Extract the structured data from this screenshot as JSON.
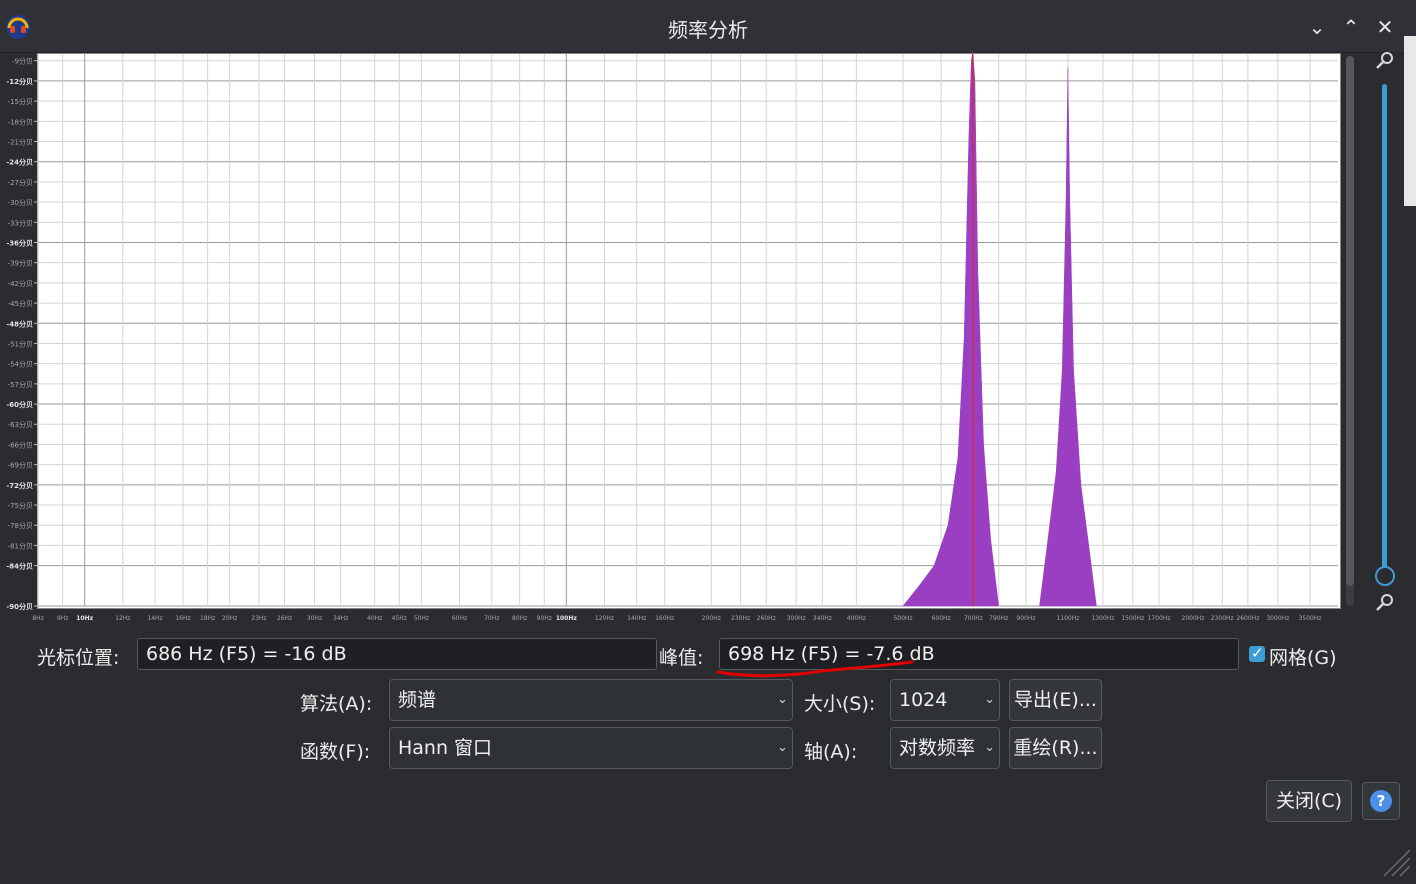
{
  "window": {
    "title": "频率分析",
    "minimize_icon": "chevron-down-icon",
    "maximize_icon": "chevron-up-icon",
    "close_icon": "close-icon",
    "minimize_glyph": "⌄",
    "maximize_glyph": "⌃",
    "close_glyph": "✕"
  },
  "chart_data": {
    "type": "area",
    "title": "",
    "xlabel": "",
    "ylabel": "",
    "x_scale": "log",
    "xlim": [
      8,
      4000
    ],
    "ylim": [
      -90,
      -8
    ],
    "grid": true,
    "y_ticks": [
      {
        "label": "-9分贝",
        "value": -9
      },
      {
        "label": "-12分贝",
        "value": -12
      },
      {
        "label": "-15分贝",
        "value": -15
      },
      {
        "label": "-18分贝",
        "value": -18
      },
      {
        "label": "-21分贝",
        "value": -21
      },
      {
        "label": "-24分贝",
        "value": -24
      },
      {
        "label": "-27分贝",
        "value": -27
      },
      {
        "label": "-30分贝",
        "value": -30
      },
      {
        "label": "-33分贝",
        "value": -33
      },
      {
        "label": "-36分贝",
        "value": -36
      },
      {
        "label": "-39分贝",
        "value": -39
      },
      {
        "label": "-42分贝",
        "value": -42
      },
      {
        "label": "-45分贝",
        "value": -45
      },
      {
        "label": "-48分贝",
        "value": -48
      },
      {
        "label": "-51分贝",
        "value": -51
      },
      {
        "label": "-54分贝",
        "value": -54
      },
      {
        "label": "-57分贝",
        "value": -57
      },
      {
        "label": "-60分贝",
        "value": -60
      },
      {
        "label": "-63分贝",
        "value": -63
      },
      {
        "label": "-66分贝",
        "value": -66
      },
      {
        "label": "-69分贝",
        "value": -69
      },
      {
        "label": "-72分贝",
        "value": -72
      },
      {
        "label": "-75分贝",
        "value": -75
      },
      {
        "label": "-78分贝",
        "value": -78
      },
      {
        "label": "-81分贝",
        "value": -81
      },
      {
        "label": "-84分贝",
        "value": -84
      },
      {
        "label": "-90分贝",
        "value": -90
      }
    ],
    "x_ticks": [
      {
        "label": "8Hz",
        "value": 8
      },
      {
        "label": "9Hz",
        "value": 9
      },
      {
        "label": "10Hz",
        "value": 10
      },
      {
        "label": "12Hz",
        "value": 12
      },
      {
        "label": "14Hz",
        "value": 14
      },
      {
        "label": "16Hz",
        "value": 16
      },
      {
        "label": "18Hz",
        "value": 18
      },
      {
        "label": "20Hz",
        "value": 20
      },
      {
        "label": "23Hz",
        "value": 23
      },
      {
        "label": "26Hz",
        "value": 26
      },
      {
        "label": "30Hz",
        "value": 30
      },
      {
        "label": "34Hz",
        "value": 34
      },
      {
        "label": "40Hz",
        "value": 40
      },
      {
        "label": "45Hz",
        "value": 45
      },
      {
        "label": "50Hz",
        "value": 50
      },
      {
        "label": "60Hz",
        "value": 60
      },
      {
        "label": "70Hz",
        "value": 70
      },
      {
        "label": "80Hz",
        "value": 80
      },
      {
        "label": "90Hz",
        "value": 90
      },
      {
        "label": "100Hz",
        "value": 100
      },
      {
        "label": "120Hz",
        "value": 120
      },
      {
        "label": "140Hz",
        "value": 140
      },
      {
        "label": "160Hz",
        "value": 160
      },
      {
        "label": "200Hz",
        "value": 200
      },
      {
        "label": "230Hz",
        "value": 230
      },
      {
        "label": "260Hz",
        "value": 260
      },
      {
        "label": "300Hz",
        "value": 300
      },
      {
        "label": "340Hz",
        "value": 340
      },
      {
        "label": "400Hz",
        "value": 400
      },
      {
        "label": "500Hz",
        "value": 500
      },
      {
        "label": "600Hz",
        "value": 600
      },
      {
        "label": "700Hz",
        "value": 700
      },
      {
        "label": "790Hz",
        "value": 790
      },
      {
        "label": "900Hz",
        "value": 900
      },
      {
        "label": "1100Hz",
        "value": 1100
      },
      {
        "label": "1300Hz",
        "value": 1300
      },
      {
        "label": "1500Hz",
        "value": 1500
      },
      {
        "label": "1700Hz",
        "value": 1700
      },
      {
        "label": "2000Hz",
        "value": 2000
      },
      {
        "label": "2300Hz",
        "value": 2300
      },
      {
        "label": "2600Hz",
        "value": 2600
      },
      {
        "label": "3000Hz",
        "value": 3000
      },
      {
        "label": "3500Hz",
        "value": 3500
      }
    ],
    "series": [
      {
        "fill": "#9b3fc2",
        "points": [
          [
            500,
            -90
          ],
          [
            540,
            -87
          ],
          [
            580,
            -84
          ],
          [
            620,
            -78
          ],
          [
            650,
            -68
          ],
          [
            670,
            -50
          ],
          [
            685,
            -20
          ],
          [
            693,
            -9
          ],
          [
            698,
            -7.6
          ],
          [
            705,
            -12
          ],
          [
            715,
            -40
          ],
          [
            735,
            -66
          ],
          [
            760,
            -80
          ],
          [
            790,
            -90
          ],
          [
            960,
            -90
          ],
          [
            1000,
            -80
          ],
          [
            1040,
            -70
          ],
          [
            1070,
            -55
          ],
          [
            1090,
            -30
          ],
          [
            1100,
            -10
          ],
          [
            1110,
            -30
          ],
          [
            1130,
            -55
          ],
          [
            1170,
            -72
          ],
          [
            1220,
            -82
          ],
          [
            1260,
            -90
          ]
        ]
      }
    ],
    "cursor_line": {
      "x": 698,
      "color": "#d42a2a"
    }
  },
  "controls": {
    "cursor_label": "光标位置:",
    "cursor_value": "686 Hz (F5) = -16 dB",
    "peak_label": "峰值:",
    "peak_value": "698 Hz (F5) = -7.6 dB",
    "grid_label": "网格(G)",
    "grid_checked": true,
    "algorithm_label": "算法(A):",
    "algorithm_value": "频谱",
    "function_label": "函数(F):",
    "function_value": "Hann 窗口",
    "size_label": "大小(S):",
    "size_value": "1024",
    "axis_label": "轴(A):",
    "axis_value": "对数频率",
    "export_button": "导出(E)...",
    "replot_button": "重绘(R)...",
    "close_button": "关闭(C)",
    "help_icon": "help-icon",
    "help_glyph": "?"
  },
  "colors": {
    "accent": "#3d9bd8",
    "spectrum_fill": "#9b3fc2",
    "annotation_red": "#e00000"
  }
}
